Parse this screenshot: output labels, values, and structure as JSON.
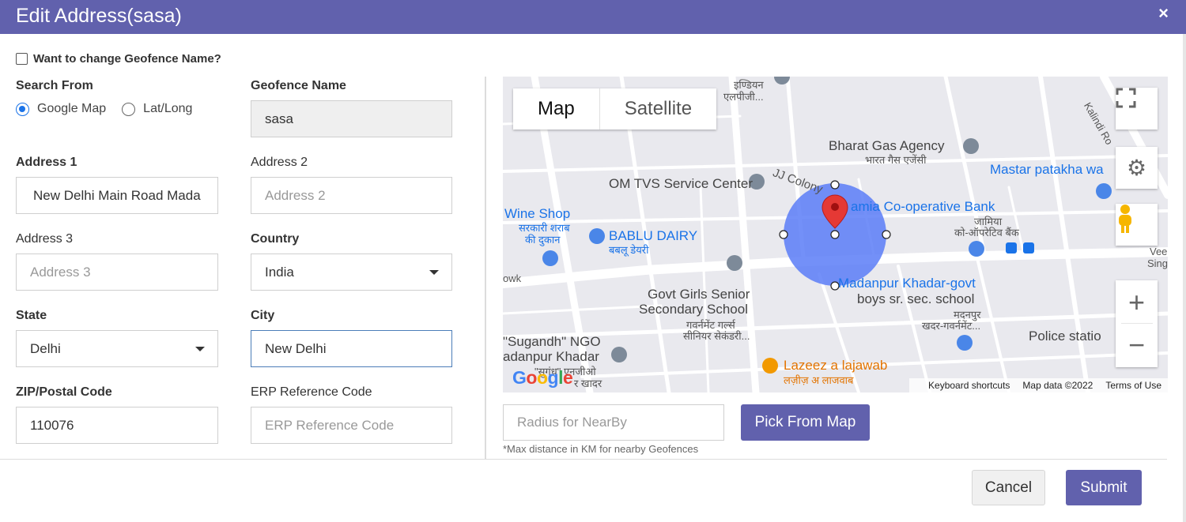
{
  "modal": {
    "title": "Edit Address(sasa)",
    "close_symbol": "×"
  },
  "geofence_toggle": {
    "label": "Want to change Geofence Name?",
    "checked": false
  },
  "search_from": {
    "label": "Search From",
    "options": [
      {
        "label": "Google Map",
        "selected": true
      },
      {
        "label": "Lat/Long",
        "selected": false
      }
    ]
  },
  "fields": {
    "geofence_name": {
      "label": "Geofence Name",
      "value": "sasa"
    },
    "address1": {
      "label": "Address 1",
      "value": "New Delhi Main Road Mada"
    },
    "address2": {
      "label": "Address 2",
      "placeholder": "Address 2"
    },
    "address3": {
      "label": "Address 3",
      "placeholder": "Address 3"
    },
    "country": {
      "label": "Country",
      "value": "India"
    },
    "state": {
      "label": "State",
      "value": "Delhi"
    },
    "city": {
      "label": "City",
      "value": "New Delhi"
    },
    "zip": {
      "label": "ZIP/Postal Code",
      "value": "110076"
    },
    "erp": {
      "label": "ERP Reference Code",
      "placeholder": "ERP Reference Code"
    }
  },
  "map": {
    "type_buttons": [
      "Map",
      "Satellite"
    ],
    "selected_type": "Map",
    "zoom_in": "+",
    "zoom_out": "−",
    "places": {
      "bharat_gas": "Bharat Gas Agency",
      "bharat_gas_hi": "भारत गैस एजेंसी",
      "mastar": "Mastar patakha wa",
      "om_tvs": "OM TVS Service Center",
      "jj_colony": "JJ Colony",
      "jamia": "amia Co-operative Bank",
      "jamia_hi1": "जामिया",
      "jamia_hi2": "को-ऑपरेटिव बैंक",
      "wine": "Wine Shop",
      "wine_hi1": "सरकारी शराब",
      "wine_hi2": "की दुकान",
      "bablu": "BABLU DAIRY",
      "bablu_hi": "बबलू डेयरी",
      "indian": "इण्डियन",
      "indian2": "एलपीजी...",
      "govt1": "Govt Girls Senior",
      "govt2": "Secondary School",
      "govt_hi1": "गवर्नमेंट गर्ल्स",
      "govt_hi2": "सीनियर सेकंडरी...",
      "madanpur1": "Madanpur Khadar-govt",
      "madanpur2": "boys sr. sec. school",
      "madanpur_hi1": "मदनपुर",
      "madanpur_hi2": "खदर-गवर्नमेंट...",
      "police": "Police statio",
      "sugandh1": "\"Sugandh\" NGO",
      "sugandh2": "adanpur Khadar",
      "sugandh_hi1": "\"सुगंध\" एनजीओ",
      "sugandh_hi2": "र खादर",
      "lazeez": "Lazeez a lajawab",
      "lazeez_hi": "लज़ीज़ अ लाजवाब",
      "owk": "owk",
      "kalindi": "Kalindi Ro",
      "vee1": "Vee",
      "vee2": "Sing"
    },
    "google": "Google",
    "footer": {
      "shortcuts": "Keyboard shortcuts",
      "data": "Map data ©2022",
      "terms": "Terms of Use"
    }
  },
  "radius": {
    "placeholder": "Radius for NearBy",
    "hint": "*Max distance in KM for nearby Geofences"
  },
  "buttons": {
    "pick": "Pick From Map",
    "cancel": "Cancel",
    "submit": "Submit"
  },
  "colors": {
    "primary": "#6161ad",
    "radius_circle": "#5b7cf7",
    "marker": "#e53935"
  }
}
